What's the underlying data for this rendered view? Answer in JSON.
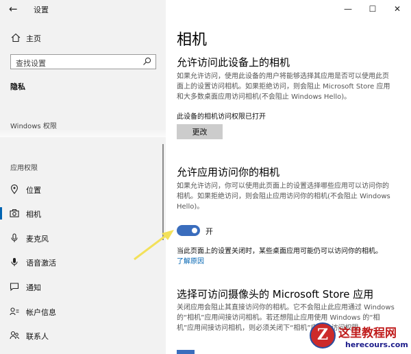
{
  "window": {
    "title": "设置",
    "back_icon": "back-arrow-icon"
  },
  "sidebar": {
    "home_label": "主页",
    "search_placeholder": "查找设置",
    "section_title": "隐私",
    "group_windows": "Windows 权限",
    "group_app": "应用权限",
    "items": [
      {
        "label": "位置",
        "icon": "location-icon",
        "active": false
      },
      {
        "label": "相机",
        "icon": "camera-icon",
        "active": true
      },
      {
        "label": "麦克风",
        "icon": "microphone-icon",
        "active": false
      },
      {
        "label": "语音激活",
        "icon": "voice-activation-icon",
        "active": false
      },
      {
        "label": "通知",
        "icon": "notification-icon",
        "active": false
      },
      {
        "label": "帐户信息",
        "icon": "account-info-icon",
        "active": false
      },
      {
        "label": "联系人",
        "icon": "contacts-icon",
        "active": false
      }
    ]
  },
  "main": {
    "title": "相机",
    "section1": {
      "heading": "允许访问此设备上的相机",
      "desc": "如果允许访问，使用此设备的用户将能够选择其应用是否可以使用此页面上的设置访问相机。如果拒绝访问，则会阻止 Microsoft Store 应用和大多数桌面应用访问相机(不会阻止 Windows Hello)。",
      "status": "此设备的相机访问权限已打开",
      "button": "更改"
    },
    "section2": {
      "heading": "允许应用访问你的相机",
      "desc": "如果允许访问，你可以使用此页面上的设置选择哪些应用可以访问你的相机。如果拒绝访问，则会阻止应用访问你的相机(不会阻止 Windows Hello)。",
      "toggle_state": "开",
      "toggle_on": true,
      "note": "当此页面上的设置关闭时，某些桌面应用可能仍可以访问你的相机。",
      "link": "了解原因"
    },
    "section3": {
      "heading": "选择可访问摄像头的 Microsoft Store 应用",
      "desc": "关闭应用会阻止其直接访问你的相机。它不会阻止此应用通过 Windows 的“相机”应用间接访问相机。若还想阻止应用使用 Windows 的“相机”应用间接访问相机，则必须关闭下“相机”应用的访问权限。"
    }
  },
  "watermark": {
    "title": "这里教程网",
    "url": "herecours.com",
    "logo_letter": "Z"
  },
  "colors": {
    "accent": "#0063b1",
    "toggle": "#3a6dbd",
    "sidebar_bg": "#f2f2f2",
    "arrow": "#f3e15a"
  }
}
